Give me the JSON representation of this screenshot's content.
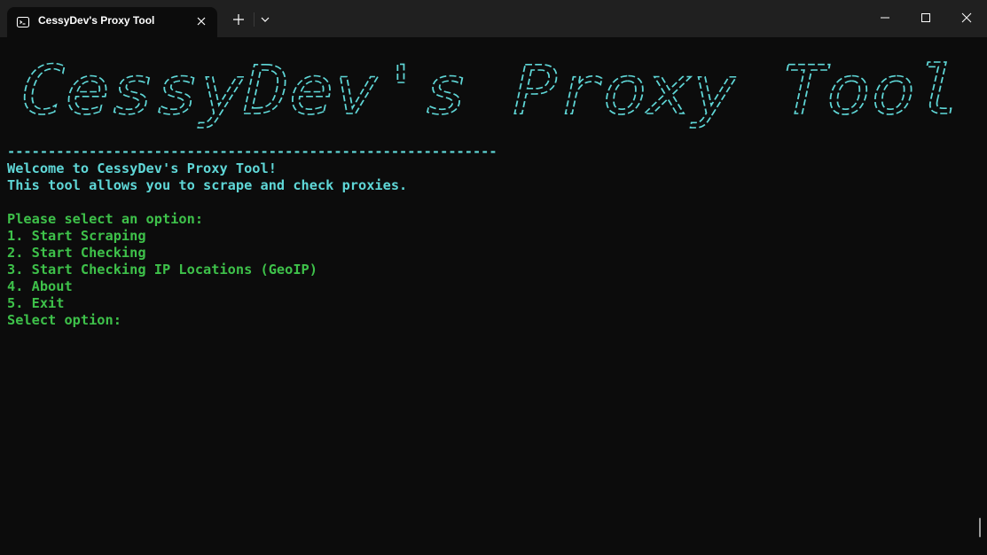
{
  "window": {
    "tab_title": "CessyDev's Proxy Tool"
  },
  "terminal": {
    "banner": {
      "text": "CessyDev's Proxy Tool",
      "color": "#5fd7d7"
    },
    "separator": "------------------------------------------------------------",
    "welcome": "Welcome to CessyDev's Proxy Tool!",
    "description": "This tool allows you to scrape and check proxies.",
    "menu_prompt": "Please select an option:",
    "options": [
      "1. Start Scraping",
      "2. Start Checking",
      "3. Start Checking IP Locations (GeoIP)",
      "4. About",
      "5. Exit"
    ],
    "input_prompt": "Select option:",
    "colors": {
      "info": "#5fd7d7",
      "menu": "#3ec14a",
      "background": "#0c0c0c"
    }
  }
}
